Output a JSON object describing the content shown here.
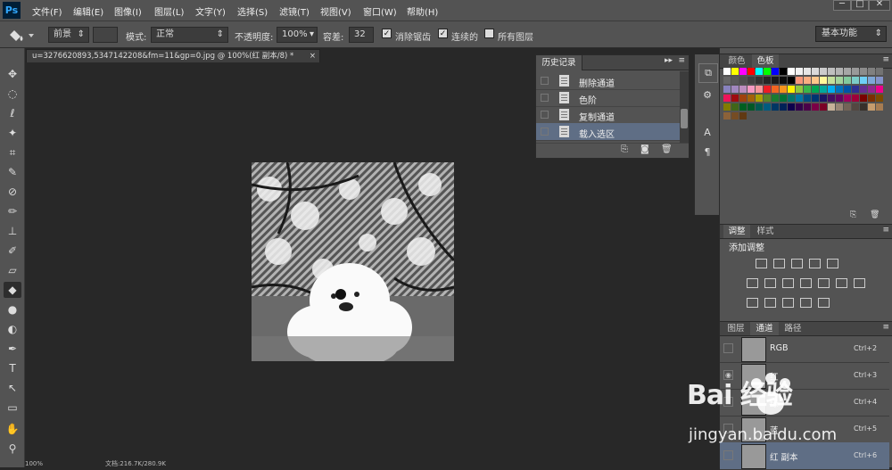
{
  "app": {
    "logo": "Ps"
  },
  "menu": [
    "文件(F)",
    "编辑(E)",
    "图像(I)",
    "图层(L)",
    "文字(Y)",
    "选择(S)",
    "滤镜(T)",
    "视图(V)",
    "窗口(W)",
    "帮助(H)"
  ],
  "window_controls": {
    "minimize": "─",
    "maximize": "□",
    "close": "✕"
  },
  "options": {
    "fill_source": "前景",
    "mode_label": "模式:",
    "mode_value": "正常",
    "opacity_label": "不透明度:",
    "opacity_value": "100%",
    "tolerance_label": "容差:",
    "tolerance_value": "32",
    "antialias_label": "消除锯齿",
    "antialias_checked": true,
    "contiguous_label": "连续的",
    "contiguous_checked": true,
    "all_layers_label": "所有图层",
    "all_layers_checked": false,
    "workspace": "基本功能"
  },
  "document": {
    "tab_title": "u=3276620893,5347142208&fm=11&gp=0.jpg @ 100%(红 副本/8) *",
    "close_glyph": "×",
    "status_zoom": "100%",
    "status_doc": "文档:216.7K/280.9K"
  },
  "history": {
    "tab": "历史记录",
    "items": [
      {
        "label": "删除通道",
        "selected": false
      },
      {
        "label": "色阶",
        "selected": false
      },
      {
        "label": "复制通道",
        "selected": false
      },
      {
        "label": "载入选区",
        "selected": true
      }
    ]
  },
  "color_panel": {
    "tabs": [
      "颜色",
      "色板"
    ],
    "active": "色板"
  },
  "swatch_colors": [
    "#ffffff",
    "#ffff00",
    "#ff00ff",
    "#ff0000",
    "#00ffff",
    "#00ff00",
    "#0000ff",
    "#000000",
    "#ffffff",
    "#f2f2f2",
    "#e6e6e6",
    "#d9d9d9",
    "#cccccc",
    "#bfbfbf",
    "#b3b3b3",
    "#a6a6a6",
    "#999999",
    "#8c8c8c",
    "#808080",
    "#737373",
    "#666666",
    "#595959",
    "#4d4d4d",
    "#404040",
    "#333333",
    "#262626",
    "#1a1a1a",
    "#0d0d0d",
    "#000000",
    "#f7977a",
    "#f9ad81",
    "#fdc68a",
    "#fff79a",
    "#c4df9b",
    "#a3d39c",
    "#82ca9d",
    "#7bcdc8",
    "#6ecff6",
    "#7ea7d8",
    "#8493ca",
    "#8882be",
    "#a187be",
    "#bc8dbf",
    "#f49ac2",
    "#f6989d",
    "#ed1c24",
    "#f26522",
    "#f7941d",
    "#fff200",
    "#8dc73f",
    "#39b54a",
    "#00a651",
    "#00a99d",
    "#00aeef",
    "#0072bc",
    "#0054a6",
    "#2e3192",
    "#662d91",
    "#92278f",
    "#ec008c",
    "#ed145b",
    "#9e0b0f",
    "#a0410d",
    "#a36209",
    "#aba000",
    "#598527",
    "#1a7b30",
    "#007236",
    "#00746b",
    "#0076a3",
    "#004b80",
    "#003471",
    "#1b1464",
    "#440e62",
    "#630460",
    "#9e005d",
    "#9e0039",
    "#790000",
    "#7b2e00",
    "#7d4900",
    "#827b00",
    "#406618",
    "#005e20",
    "#005826",
    "#005952",
    "#005b7f",
    "#003663",
    "#002157",
    "#0d004c",
    "#32004b",
    "#4b0049",
    "#7b0046",
    "#7a0026",
    "#c7b299",
    "#998675",
    "#736357",
    "#534741",
    "#37302a",
    "#c69c6d",
    "#a67c52",
    "#8c6239",
    "#754c24",
    "#603913"
  ],
  "adjust_panel": {
    "tabs": [
      "调整",
      "样式"
    ],
    "active": "调整",
    "title": "添加调整"
  },
  "channels_panel": {
    "tabs": [
      "图层",
      "通道",
      "路径"
    ],
    "active": "通道",
    "channels": [
      {
        "name": "RGB",
        "shortcut": "Ctrl+2",
        "visible": false,
        "selected": false
      },
      {
        "name": "红",
        "shortcut": "Ctrl+3",
        "visible": true,
        "selected": false
      },
      {
        "name": "绿",
        "shortcut": "Ctrl+4",
        "visible": false,
        "selected": false
      },
      {
        "name": "蓝",
        "shortcut": "Ctrl+5",
        "visible": false,
        "selected": false
      },
      {
        "name": "红 副本",
        "shortcut": "Ctrl+6",
        "visible": false,
        "selected": true
      }
    ]
  },
  "watermark": {
    "brand": "Bai 经验",
    "url": "jingyan.baidu.com"
  }
}
